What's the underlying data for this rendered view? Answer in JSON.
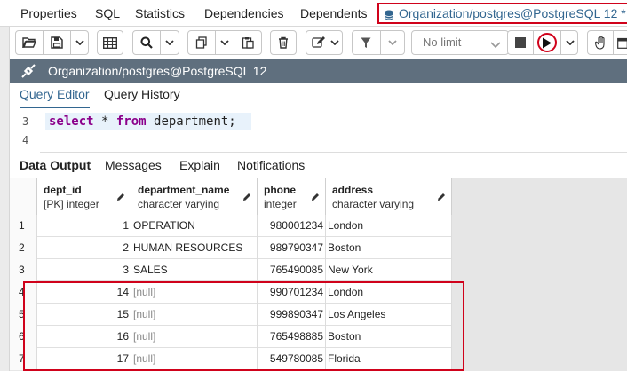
{
  "tabs": [
    {
      "label": "Properties"
    },
    {
      "label": "SQL"
    },
    {
      "label": "Statistics"
    },
    {
      "label": "Dependencies"
    },
    {
      "label": "Dependents"
    }
  ],
  "active_tab": {
    "label": "Organization/postgres@PostgreSQL 12 *"
  },
  "toolbar": {
    "limit": {
      "selected": "No limit"
    },
    "icons": [
      "open-file-icon",
      "save-icon",
      "chevron-down-icon",
      "table-icon",
      "search-icon",
      "chevron-down-icon",
      "copy-icon",
      "chevron-down-icon",
      "paste-icon",
      "delete-icon",
      "edit-icon",
      "chevron-down-icon",
      "filter-icon",
      "chevron-down-icon",
      "stop-icon",
      "execute-icon",
      "chevron-down-icon",
      "hand-icon",
      "calendar-icon"
    ]
  },
  "titlebar": {
    "title": "Organization/postgres@PostgreSQL 12"
  },
  "query_tabs": [
    {
      "label": "Query Editor"
    },
    {
      "label": "Query History"
    }
  ],
  "editor": {
    "line_numbers": [
      "3",
      "4"
    ],
    "kw_select": "select",
    "star": " * ",
    "kw_from": "from",
    "rest": " department;"
  },
  "output_tabs": [
    {
      "label": "Data Output"
    },
    {
      "label": "Messages"
    },
    {
      "label": "Explain"
    },
    {
      "label": "Notifications"
    }
  ],
  "grid": {
    "columns": [
      {
        "name": "dept_id",
        "type": "[PK] integer"
      },
      {
        "name": "department_name",
        "type": "character varying"
      },
      {
        "name": "phone",
        "type": "integer"
      },
      {
        "name": "address",
        "type": "character varying"
      }
    ],
    "rows": [
      {
        "n": "1",
        "dept_id": "1",
        "department_name": "OPERATION",
        "phone": "980001234",
        "address": "London"
      },
      {
        "n": "2",
        "dept_id": "2",
        "department_name": "HUMAN RESOURCES",
        "phone": "989790347",
        "address": "Boston"
      },
      {
        "n": "3",
        "dept_id": "3",
        "department_name": "SALES",
        "phone": "765490085",
        "address": "New York"
      },
      {
        "n": "4",
        "dept_id": "14",
        "department_name": "[null]",
        "phone": "990701234",
        "address": "London"
      },
      {
        "n": "5",
        "dept_id": "15",
        "department_name": "[null]",
        "phone": "999890347",
        "address": "Los Angeles"
      },
      {
        "n": "6",
        "dept_id": "16",
        "department_name": "[null]",
        "phone": "765498885",
        "address": "Boston"
      },
      {
        "n": "7",
        "dept_id": "17",
        "department_name": "[null]",
        "phone": "549780085",
        "address": "Florida"
      }
    ]
  },
  "colors": {
    "accent": "#326690",
    "highlight": "#d0021b",
    "titlebar": "#5f6f7e"
  }
}
